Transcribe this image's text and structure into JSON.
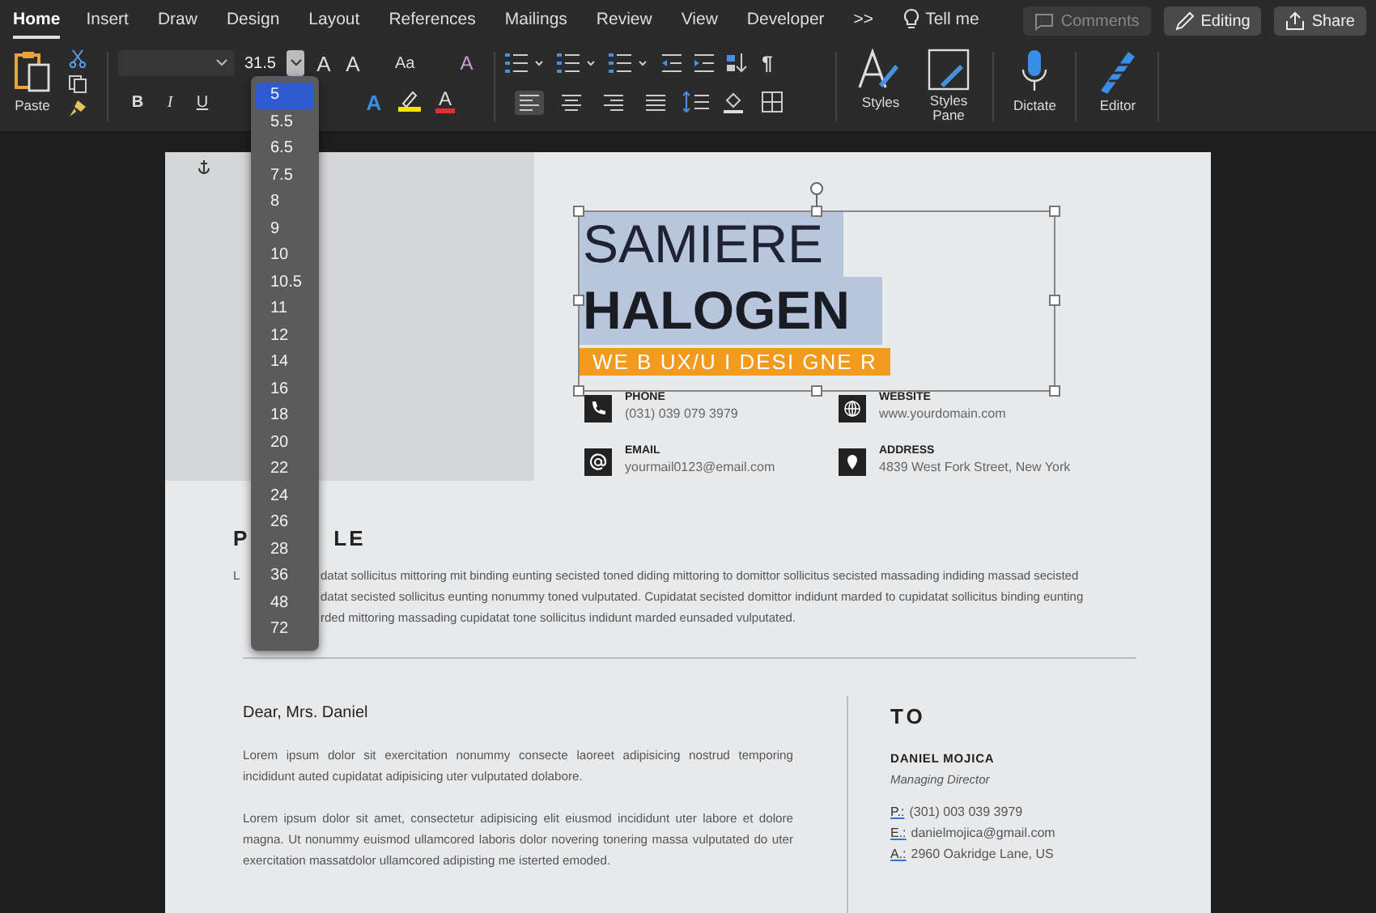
{
  "tabs": [
    {
      "label": "Home",
      "selected": true
    },
    {
      "label": "Insert",
      "selected": false
    },
    {
      "label": "Draw",
      "selected": false
    },
    {
      "label": "Design",
      "selected": false
    },
    {
      "label": "Layout",
      "selected": false
    },
    {
      "label": "References",
      "selected": false
    },
    {
      "label": "Mailings",
      "selected": false
    },
    {
      "label": "Review",
      "selected": false
    },
    {
      "label": "View",
      "selected": false
    },
    {
      "label": "Developer",
      "selected": false
    }
  ],
  "overflow": ">>",
  "tell_me": "Tell me",
  "header_buttons": [
    {
      "kind": "comments",
      "label": "Comments",
      "disabled": true
    },
    {
      "kind": "editing",
      "label": "Editing",
      "disabled": false
    },
    {
      "kind": "share",
      "label": "Share",
      "disabled": false
    }
  ],
  "ribbon": {
    "paste": "Paste",
    "font_size": "31.5",
    "font_row1": [
      {
        "kind": "grow",
        "glyph": "A"
      },
      {
        "kind": "shrink",
        "glyph": "A"
      },
      {
        "kind": "case",
        "glyph": "Aa"
      },
      {
        "kind": "clear",
        "glyph": "A"
      }
    ],
    "font_row2": [
      {
        "kind": "bold",
        "glyph": "B"
      },
      {
        "kind": "italic",
        "glyph": "I"
      },
      {
        "kind": "underline",
        "glyph": "U"
      }
    ],
    "font_row2b": [
      {
        "kind": "effects",
        "glyph": "A"
      },
      {
        "kind": "highlight"
      },
      {
        "kind": "color",
        "glyph": "A"
      }
    ],
    "align": [
      {
        "kind": "left",
        "selected": true
      },
      {
        "kind": "center",
        "selected": false
      },
      {
        "kind": "right",
        "selected": false
      },
      {
        "kind": "justify",
        "selected": false
      }
    ],
    "pilcrow": "¶",
    "styles": "Styles",
    "styles_pane": "Styles Pane",
    "dictate": "Dictate",
    "editor": "Editor",
    "size_options": [
      {
        "label": "5",
        "selected": true
      },
      {
        "label": "5.5",
        "selected": false
      },
      {
        "label": "6.5",
        "selected": false
      },
      {
        "label": "7.5",
        "selected": false
      },
      {
        "label": "8",
        "selected": false
      },
      {
        "label": "9",
        "selected": false
      },
      {
        "label": "10",
        "selected": false
      },
      {
        "label": "10.5",
        "selected": false
      },
      {
        "label": "11",
        "selected": false
      },
      {
        "label": "12",
        "selected": false
      },
      {
        "label": "14",
        "selected": false
      },
      {
        "label": "16",
        "selected": false
      },
      {
        "label": "18",
        "selected": false
      },
      {
        "label": "20",
        "selected": false
      },
      {
        "label": "22",
        "selected": false
      },
      {
        "label": "24",
        "selected": false
      },
      {
        "label": "26",
        "selected": false
      },
      {
        "label": "28",
        "selected": false
      },
      {
        "label": "36",
        "selected": false
      },
      {
        "label": "48",
        "selected": false
      },
      {
        "label": "72",
        "selected": false
      }
    ]
  },
  "resume": {
    "first_name": "SAMIERE",
    "last_name": "HALOGEN",
    "role": "WE B UX/U I DESI GNE R",
    "contacts": [
      {
        "kind": "phone",
        "label": "PHONE",
        "value": "(031) 039 079 3979"
      },
      {
        "kind": "website",
        "label": "WEBSITE",
        "value": "www.yourdomain.com"
      },
      {
        "kind": "email",
        "label": "EMAIL",
        "value": "yourmail0123@email.com"
      },
      {
        "kind": "address",
        "label": "ADDRESS",
        "value": "4839 West Fork Street, New York"
      }
    ],
    "profile": {
      "heading_start": "P",
      "heading_end": "LE",
      "lines": [
        {
          "start": "L",
          "end": "datat sollicitus mittoring mit binding eunting secisted toned diding mittoring to domittor sollicitus secisted massading indiding massad secisted"
        },
        {
          "end": "datat secisted sollicitus eunting nonummy toned vulputated. Cupidatat secisted domittor indidunt marded to cupidatat sollicitus binding eunting"
        },
        {
          "end": "rded mittoring massading cupidatat tone sollicitus indidunt marded eunsaded vulputated."
        }
      ]
    },
    "letter": {
      "greeting": "Dear, Mrs. Daniel",
      "paragraphs": [
        "Lorem ipsum dolor sit exercitation nonummy consecte laoreet adipisicing nostrud temporing incididunt auted cupidatat adipisicing uter vulputated dolabore.",
        "Lorem ipsum dolor sit amet, consectetur adipisicing elit eiusmod incididunt uter labore et dolore magna. Ut nonummy euismod ullamcored laboris dolor novering tonering massa vulputated do uter exercitation massatdolor ullamcored adipisting me isterted emoded."
      ]
    },
    "recipient": {
      "heading": "TO",
      "name": "DANIEL MOJICA",
      "position": "Managing Director",
      "lines": [
        {
          "label": "P.:",
          "value": "(301)  003  039  3979"
        },
        {
          "label": "E.:",
          "value": "danielmojica@gmail.com"
        },
        {
          "label": "A.:",
          "value": "2960 Oakridge Lane, US"
        }
      ]
    }
  }
}
